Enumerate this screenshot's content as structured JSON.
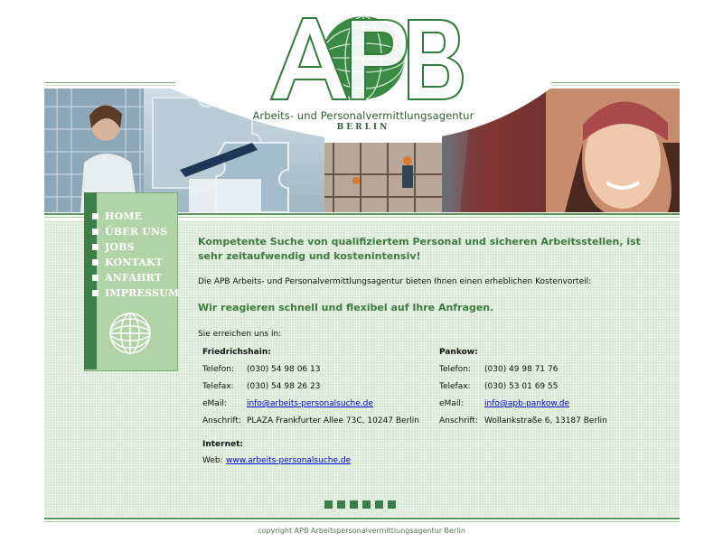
{
  "logo": {
    "letters": "APB",
    "subtitle": "Arbeits- und Personalvermittlungsagentur",
    "city": "BERLIN"
  },
  "menu": {
    "items": [
      {
        "label": "HOME"
      },
      {
        "label": "ÜBER UNS"
      },
      {
        "label": "JOBS"
      },
      {
        "label": "KONTAKT"
      },
      {
        "label": "ANFAHRT"
      },
      {
        "label": "IMPRESSUM"
      }
    ]
  },
  "main": {
    "headline": "Kompetente Suche von qualifiziertem Personal und sicheren Arbeitsstellen, ist sehr zeitaufwendig und kostenintensiv!",
    "intro": "Die APB Arbeits- und Personalvermittlungsagentur bieten Ihnen einen erheblichen Kostenvorteil:",
    "headline2": "Wir reagieren schnell und flexibel auf Ihre Anfragen.",
    "reach": "Sie erreichen uns in:"
  },
  "contacts": {
    "friedrichshain": {
      "title": "Friedrichshain:",
      "phone_label": "Telefon:",
      "phone": "(030) 54 98 06 13",
      "fax_label": "Telefax:",
      "fax": "(030) 54 98 26 23",
      "email_label": "eMail:",
      "email": "info@arbeits-personalsuche.de",
      "address_label": "Anschrift:",
      "address": "PLAZA Frankfurter Allee 73C, 10247 Berlin"
    },
    "pankow": {
      "title": "Pankow:",
      "phone_label": "Telefon:",
      "phone": "(030) 49 98 71 76",
      "fax_label": "Telefax:",
      "fax": "(030) 53 01 69 55",
      "email_label": "eMail:",
      "email": "info@apb-pankow.de",
      "address_label": "Anschrift:",
      "address": "Wollankstraße 6, 13187 Berlin"
    },
    "internet": {
      "title": "Internet:",
      "web_label": "Web:",
      "web": "www.arbeits-personalsuche.de"
    }
  },
  "footer": {
    "copyright": "copyright APB Arbeitspersonalvermittlungsagentur Berlin"
  },
  "colors": {
    "brand_green": "#3e7a42",
    "menu_bg": "#b2d3a8",
    "menu_bar": "#3e7e48",
    "content_bg": "#d6e8d2",
    "link": "#0000cc"
  },
  "icons": [
    "globe-logo-icon",
    "menu-bullet-icon",
    "globe-icon"
  ]
}
